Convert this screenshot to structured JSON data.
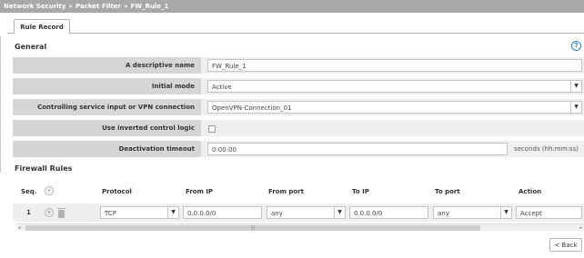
{
  "breadcrumb": [
    "Network Security",
    "Packet Filter",
    "FW_Rule_1"
  ],
  "breadcrumb_sep": "»",
  "tab": {
    "label": "Rule Record"
  },
  "general": {
    "title": "General",
    "help": "?",
    "fields": {
      "name": {
        "label": "A descriptive name",
        "value": "FW_Rule_1"
      },
      "mode": {
        "label": "Initial mode",
        "value": "Active"
      },
      "controlling": {
        "label": "Controlling service input or VPN connection",
        "value": "OpenVPN-Connection_01"
      },
      "inverted": {
        "label": "Use inverted control logic",
        "checked": false
      },
      "timeout": {
        "label": "Deactivation timeout",
        "value": "0:00:00",
        "unit": "seconds (hh:mm:ss)"
      }
    }
  },
  "firewall": {
    "title": "Firewall Rules",
    "columns": {
      "seq": "Seq.",
      "protocol": "Protocol",
      "from_ip": "From IP",
      "from_port": "From port",
      "to_ip": "To IP",
      "to_port": "To port",
      "action": "Action"
    },
    "rows": [
      {
        "seq": "1",
        "protocol": "TCP",
        "from_ip": "0.0.0.0/0",
        "from_port": "any",
        "to_ip": "0.0.0.0/0",
        "to_port": "any",
        "action": "Accept"
      }
    ]
  },
  "scroll_grip": "|||",
  "arrows": {
    "dropdown": "▼",
    "left": "◂",
    "right": "▸"
  },
  "buttons": {
    "back": "< Back"
  }
}
